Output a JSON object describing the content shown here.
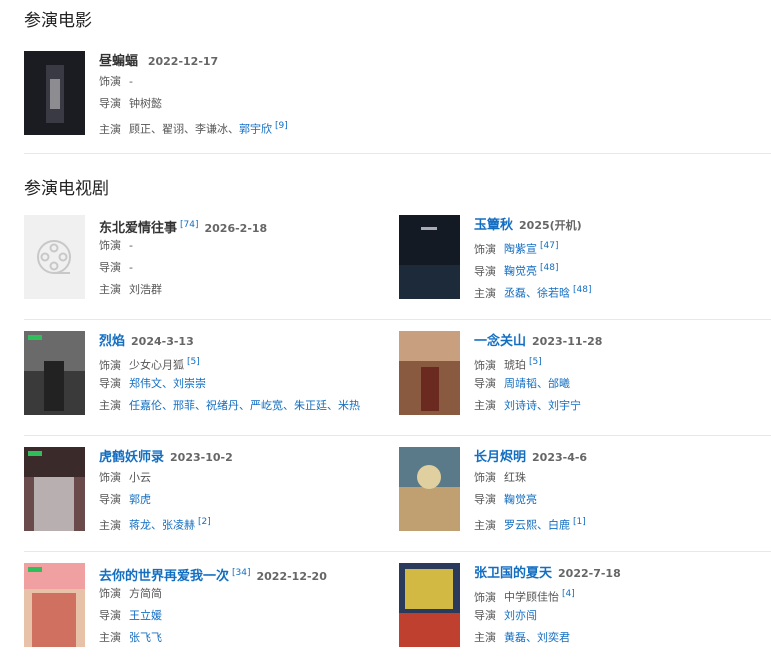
{
  "movies_section": {
    "title": "参演电影"
  },
  "tv_section": {
    "title": "参演电视剧"
  },
  "labels": {
    "role": "饰演",
    "director": "导演",
    "cast": "主演"
  },
  "movies": [
    {
      "title": "昼蝙蝠",
      "date": "2022-12-17",
      "role": "-",
      "director": "钟树懿",
      "cast_plain": "顾正、翟诩、李谦冰、",
      "cast_links": "郭宇欣",
      "cast_ref": "[9]"
    }
  ],
  "tv": [
    {
      "title": "东北爱情往事",
      "ref": "[74]",
      "date": "2026-2-18",
      "role": "-",
      "director": "-",
      "cast": "刘浩群"
    },
    {
      "title": "玉簟秋",
      "date": "2025(开机)",
      "role": "陶紫宣",
      "role_ref": "[47]",
      "director": "鞠觉亮",
      "director_ref": "[48]",
      "cast": "丞磊、徐若晗",
      "cast_ref": "[48]"
    },
    {
      "title": "烈焰",
      "date": "2024-3-13",
      "role": "少女心月狐",
      "role_ref": "[5]",
      "director": "郑伟文、刘崇崇",
      "cast": "任嘉伦、邢菲、祝绪丹、严屹宽、朱正廷、米热"
    },
    {
      "title": "一念关山",
      "date": "2023-11-28",
      "role": "琥珀",
      "role_ref": "[5]",
      "director": "周靖韬、邰曦",
      "cast": "刘诗诗、刘宇宁"
    },
    {
      "title": "虎鹤妖师录",
      "date": "2023-10-2",
      "role": "小云",
      "director": "郭虎",
      "cast": "蒋龙、张凌赫",
      "cast_ref": "[2]"
    },
    {
      "title": "长月烬明",
      "date": "2023-4-6",
      "role": "红珠",
      "director": "鞠觉亮",
      "cast": "罗云熙、白鹿",
      "cast_ref": "[1]"
    },
    {
      "title": "去你的世界再爱我一次",
      "ref": "[34]",
      "date": "2022-12-20",
      "role": "方简简",
      "director": "王立媛",
      "cast": "张飞飞"
    },
    {
      "title": "张卫国的夏天",
      "date": "2022-7-18",
      "role": "中学顾佳怡",
      "role_ref": "[4]",
      "director": "刘亦闯",
      "cast": "黄磊、刘奕君"
    }
  ],
  "posters": {
    "placeholder_icon": "film-reel-icon",
    "colors": [
      "#1b1b22",
      "#1c2a3a",
      "#3a3a3a",
      "#8a5a40",
      "#6a4a4a",
      "#5a7a8a",
      "#e8c2a8",
      "#2a3a5a"
    ]
  }
}
